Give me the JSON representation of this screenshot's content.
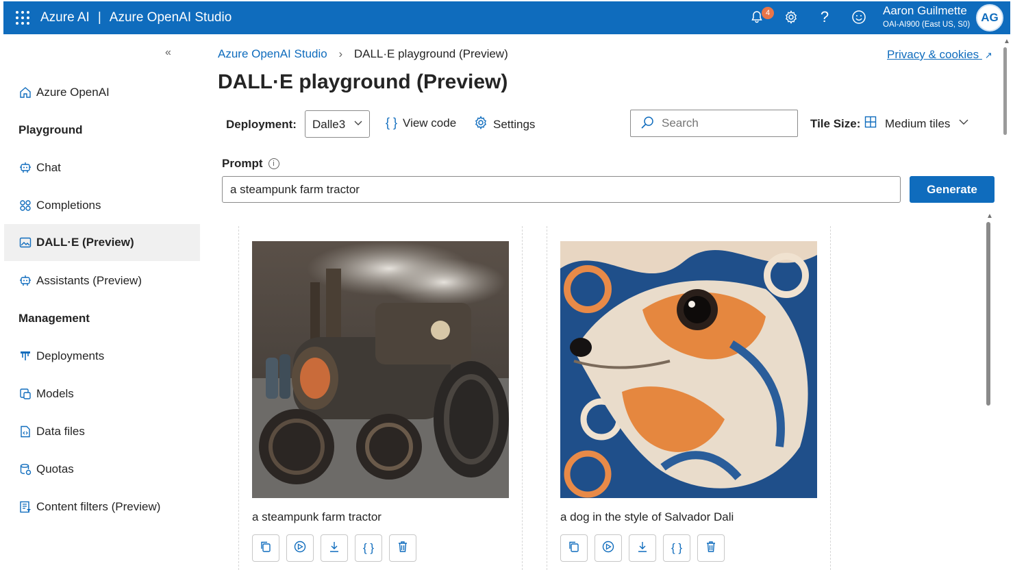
{
  "header": {
    "brand": "Azure AI",
    "separator": "|",
    "app_name": "Azure OpenAI Studio",
    "notification_count": "4",
    "user_name": "Aaron Guilmette",
    "user_subtitle": "OAI-AI900 (East US, S0)",
    "avatar_initials": "AG"
  },
  "sidebar": {
    "collapse": "«",
    "home": "Azure OpenAI",
    "section_playground": "Playground",
    "playground_items": [
      {
        "label": "Chat",
        "icon": "chat-icon"
      },
      {
        "label": "Completions",
        "icon": "completions-icon"
      },
      {
        "label": "DALL·E (Preview)",
        "icon": "image-icon",
        "active": true
      },
      {
        "label": "Assistants (Preview)",
        "icon": "assistant-icon"
      }
    ],
    "section_management": "Management",
    "management_items": [
      {
        "label": "Deployments",
        "icon": "deployments-icon"
      },
      {
        "label": "Models",
        "icon": "models-icon"
      },
      {
        "label": "Data files",
        "icon": "data-files-icon"
      },
      {
        "label": "Quotas",
        "icon": "quotas-icon"
      },
      {
        "label": "Content filters (Preview)",
        "icon": "content-filters-icon"
      }
    ]
  },
  "breadcrumb": {
    "root": "Azure OpenAI Studio",
    "current": "DALL·E playground (Preview)"
  },
  "privacy_link": "Privacy & cookies",
  "page_title": "DALL·E playground (Preview)",
  "toolbar": {
    "deployment_label": "Deployment:",
    "deployment_value": "Dalle3",
    "view_code": "View code",
    "settings": "Settings",
    "search_placeholder": "Search",
    "tile_size_label": "Tile Size:",
    "tile_size_value": "Medium tiles"
  },
  "prompt": {
    "label": "Prompt",
    "value": "a steampunk farm tractor",
    "generate_label": "Generate"
  },
  "gallery": [
    {
      "caption": "a steampunk farm tractor"
    },
    {
      "caption": "a dog in the style of Salvador Dali"
    }
  ],
  "colors": {
    "brand_blue": "#0f6cbd",
    "badge_orange": "#e97548"
  }
}
